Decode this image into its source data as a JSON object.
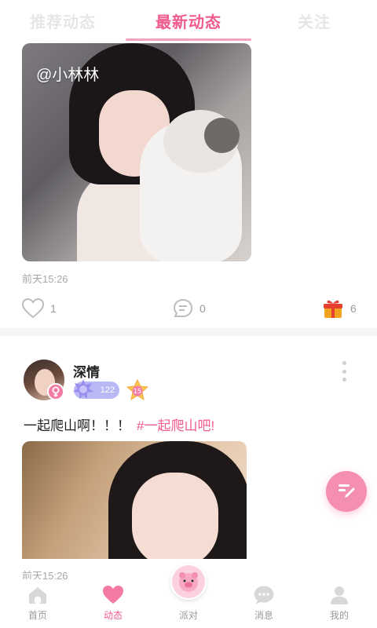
{
  "tabs": [
    {
      "label": "推荐动态"
    },
    {
      "label": "最新动态"
    },
    {
      "label": "关注"
    }
  ],
  "post1": {
    "watermark": "@小林林",
    "time": "前天15:26",
    "likes": "1",
    "comments": "0",
    "gifts": "6"
  },
  "post2": {
    "username": "深情",
    "level": "122",
    "vip_level": "15",
    "text": "一起爬山啊！！！",
    "tag": "#一起爬山吧!",
    "time": "前天15:26"
  },
  "nav": {
    "home": "首页",
    "feed": "动态",
    "party": "派对",
    "messages": "消息",
    "mine": "我的"
  },
  "colors": {
    "accent": "#f05a8c",
    "inactive": "#9a9a9a"
  }
}
